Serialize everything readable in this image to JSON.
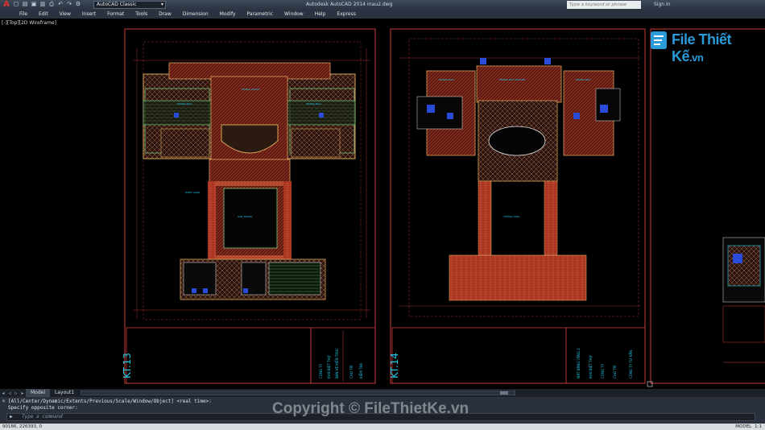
{
  "app": {
    "title": "Autodesk AutoCAD 2014    mau2.dwg",
    "workspace": "AutoCAD Classic",
    "search_placeholder": "Type a keyword or phrase",
    "signin": "Sign In"
  },
  "menu": [
    "File",
    "Edit",
    "View",
    "Insert",
    "Format",
    "Tools",
    "Draw",
    "Dimension",
    "Modify",
    "Parametric",
    "Window",
    "Help",
    "Express"
  ],
  "viewport": {
    "label": "[-][Top][2D Wireframe]"
  },
  "sheets": [
    {
      "id": "KT.13"
    },
    {
      "id": "KT.14"
    }
  ],
  "layout_tabs": [
    "Model",
    "Layout1"
  ],
  "command": {
    "history": [
      "[All/Center/Dynamic/Extents/Previous/Scale/Window/Object] <real time>:",
      "Specify opposite corner:"
    ],
    "prompt_placeholder": "Type a command"
  },
  "status": {
    "coords": "90186, 226393, 0",
    "right": [
      "MODEL",
      "1:1"
    ]
  },
  "watermark": {
    "brand": "File Thiết Kế",
    "brand_tld": ".vn",
    "copyright": "Copyright © FileThietKe.vn"
  },
  "colors": {
    "accent": "#2a9ad9",
    "frame": "#c83a3a",
    "wall": "#b44a2e",
    "floor": "#8b2a1e",
    "cyan": "#21c8e8"
  }
}
